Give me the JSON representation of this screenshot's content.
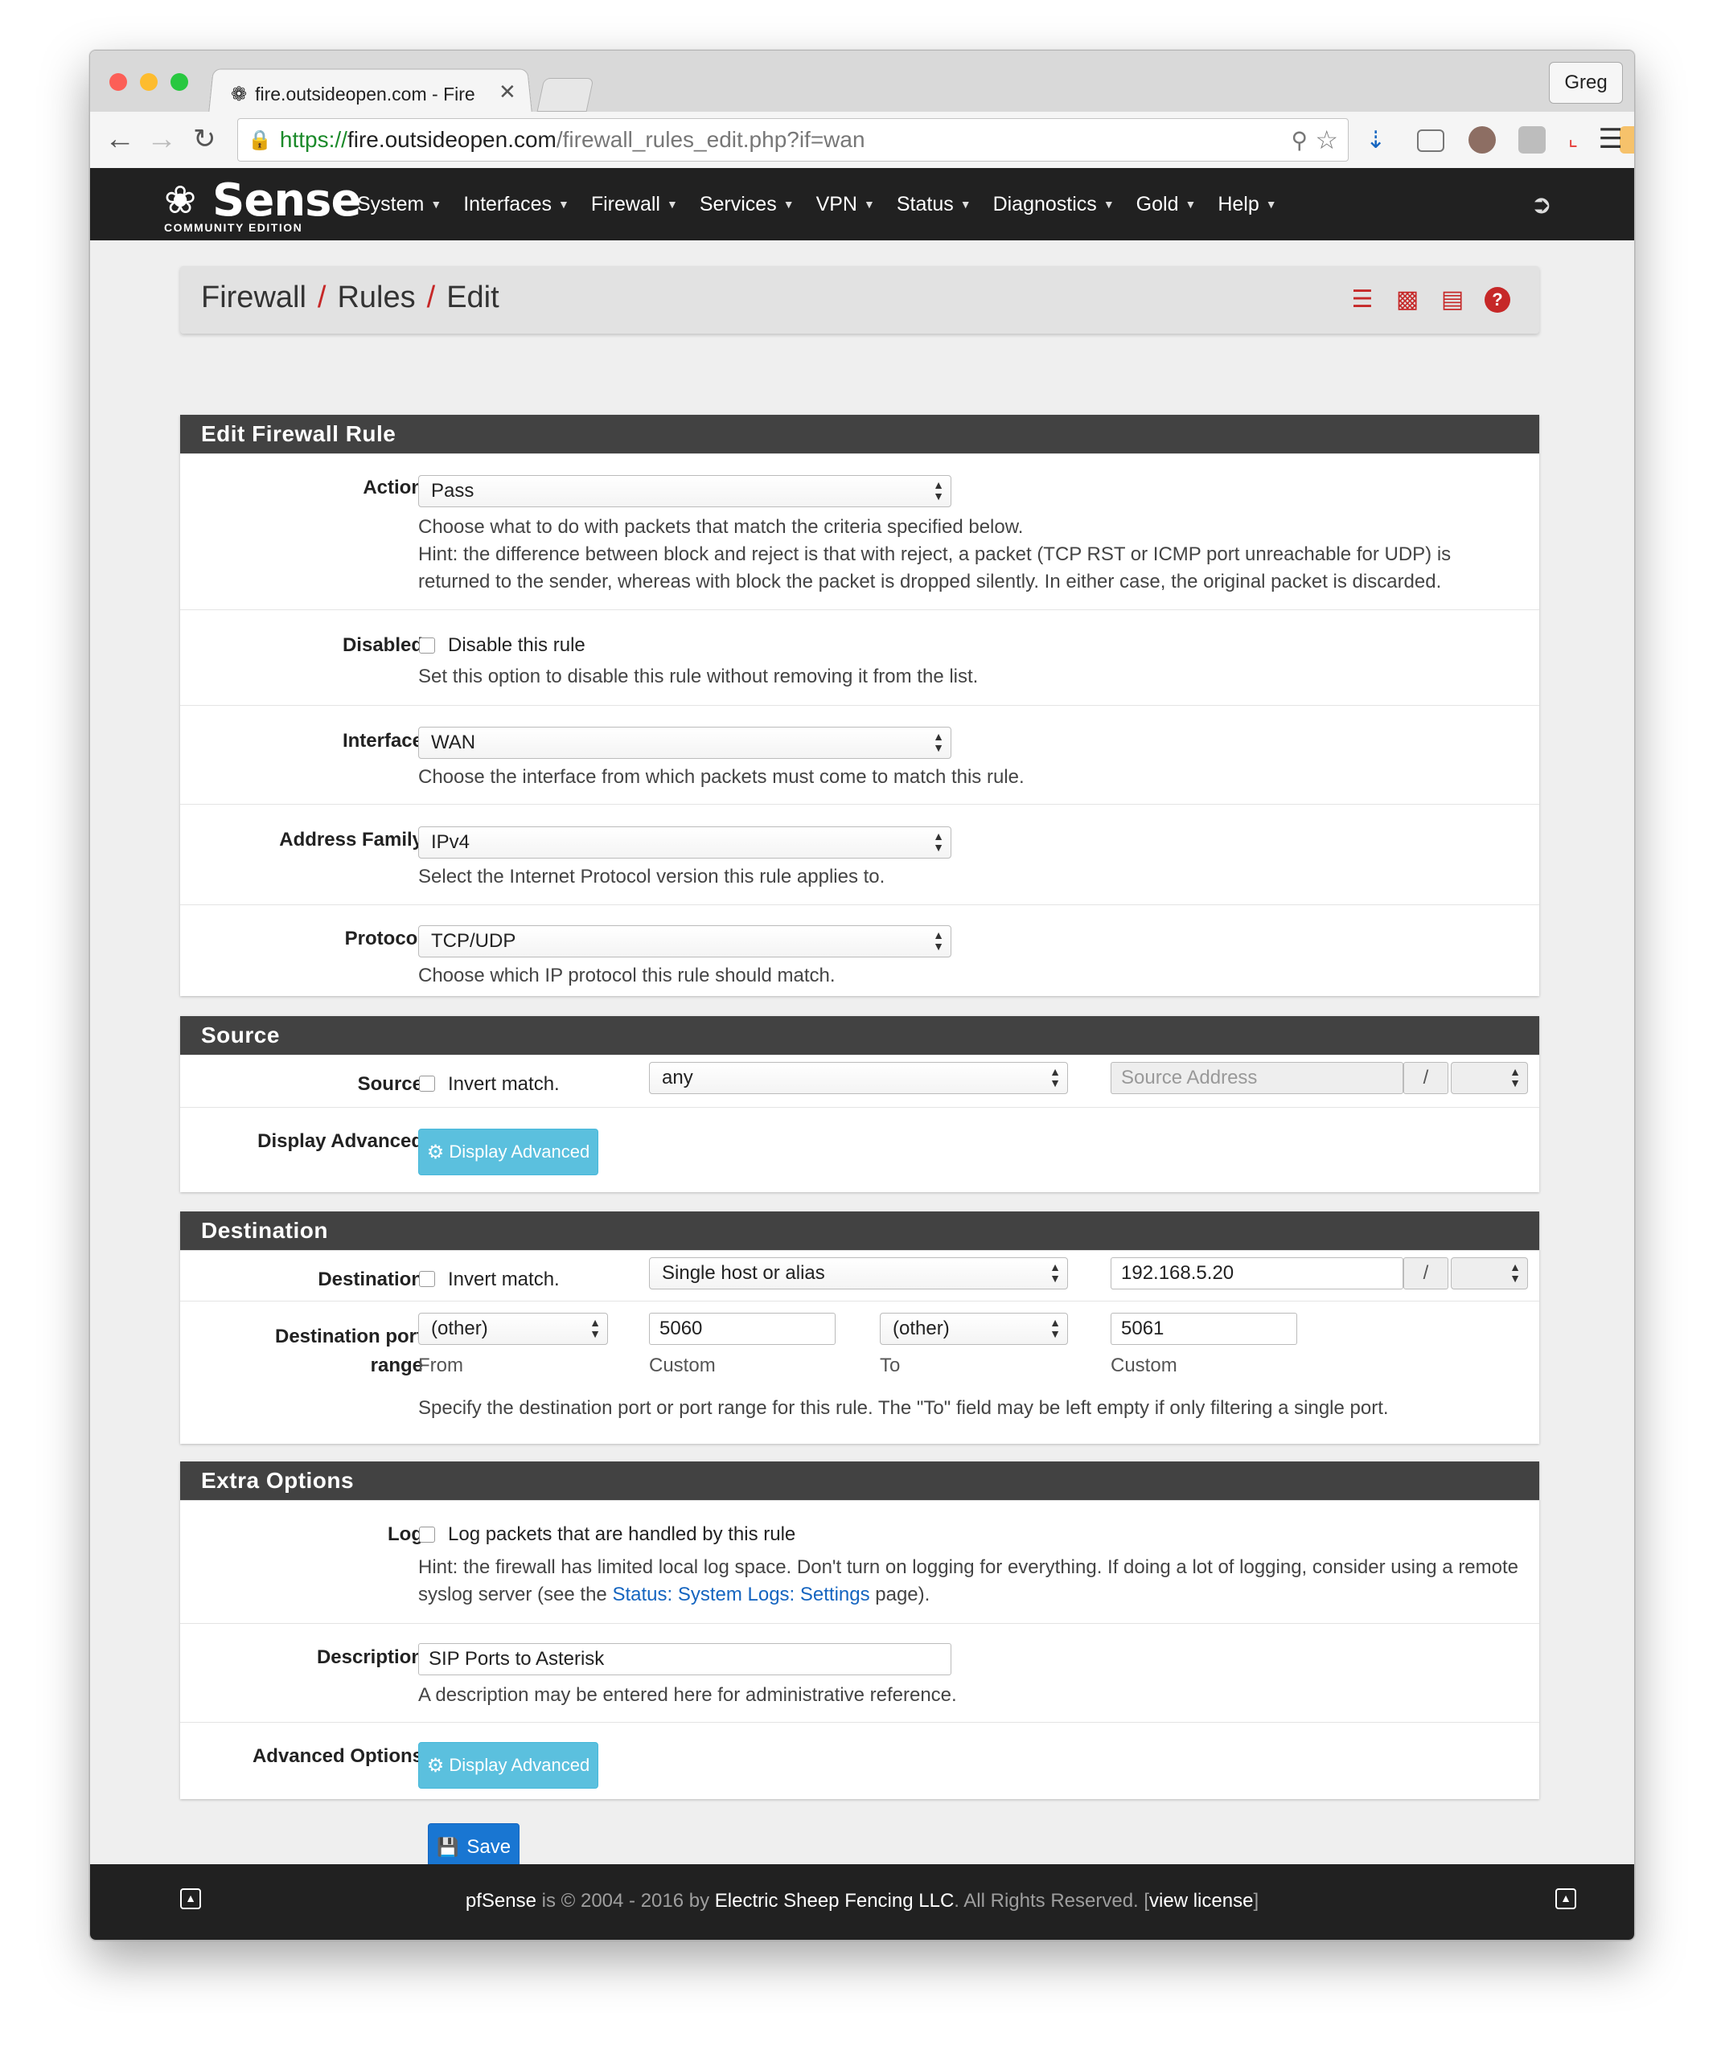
{
  "browser": {
    "tab_title": "fire.outsideopen.com - Fire",
    "tab_close": "✕",
    "profile_name": "Greg",
    "url_protocol": "https://",
    "url_host": "fire.outsideopen.com",
    "url_path": "/firewall_rules_edit.php?if=wan"
  },
  "nav": {
    "brand_name": "Sense",
    "brand_sub": "COMMUNITY EDITION",
    "menu": [
      "System",
      "Interfaces",
      "Firewall",
      "Services",
      "VPN",
      "Status",
      "Diagnostics",
      "Gold",
      "Help"
    ]
  },
  "breadcrumb": {
    "items": [
      "Firewall",
      "Rules",
      "Edit"
    ],
    "separator": "/"
  },
  "edit_rule": {
    "title": "Edit Firewall Rule",
    "action": {
      "label": "Action",
      "value": "Pass",
      "help1": "Choose what to do with packets that match the criteria specified below.",
      "help2": "Hint: the difference between block and reject is that with reject, a packet (TCP RST or ICMP port unreachable for UDP) is returned to the sender, whereas with block the packet is dropped silently. In either case, the original packet is discarded."
    },
    "disabled": {
      "label": "Disabled",
      "checkbox_label": "Disable this rule",
      "checked": false,
      "help": "Set this option to disable this rule without removing it from the list."
    },
    "interface": {
      "label": "Interface",
      "value": "WAN",
      "help": "Choose the interface from which packets must come to match this rule."
    },
    "address_family": {
      "label": "Address Family",
      "value": "IPv4",
      "help": "Select the Internet Protocol version this rule applies to."
    },
    "protocol": {
      "label": "Protocol",
      "value": "TCP/UDP",
      "help": "Choose which IP protocol this rule should match."
    }
  },
  "source": {
    "title": "Source",
    "label": "Source",
    "invert_label": "Invert match.",
    "type_value": "any",
    "address_placeholder": "Source Address",
    "slash": "/",
    "display_advanced_label": "Display Advanced",
    "display_advanced_button": "Display Advanced"
  },
  "destination": {
    "title": "Destination",
    "label": "Destination",
    "invert_label": "Invert match.",
    "type_value": "Single host or alias",
    "address_value": "192.168.5.20",
    "slash": "/",
    "port_label_line1": "Destination port",
    "port_label_line2": "range",
    "from_select": "(other)",
    "from_custom": "5060",
    "to_select": "(other)",
    "to_custom": "5061",
    "from_caption": "From",
    "custom_caption": "Custom",
    "to_caption": "To",
    "help": "Specify the destination port or port range for this rule. The \"To\" field may be left empty if only filtering a single port."
  },
  "extra": {
    "title": "Extra Options",
    "log_label": "Log",
    "log_checkbox_label": "Log packets that are handled by this rule",
    "log_help_prefix": "Hint: the firewall has limited local log space. Don't turn on logging for everything. If doing a lot of logging, consider using a remote syslog server (see the ",
    "log_help_link": "Status: System Logs: Settings",
    "log_help_suffix": " page).",
    "description_label": "Description",
    "description_value": "SIP Ports to Asterisk",
    "description_help": "A description may be entered here for administrative reference.",
    "advanced_label": "Advanced Options",
    "advanced_button": "Display Advanced"
  },
  "save_button": "Save",
  "footer": {
    "product": "pfSense",
    "text1": " is © 2004 - 2016 by ",
    "company": "Electric Sheep Fencing LLC",
    "text2": ". All Rights Reserved. [",
    "license": "view license",
    "text3": "]"
  },
  "colors": {
    "accent_red": "#c62828",
    "nav_bg": "#212121",
    "panel_head": "#424242",
    "info_button": "#5bc0de",
    "save_button": "#1976d2"
  }
}
